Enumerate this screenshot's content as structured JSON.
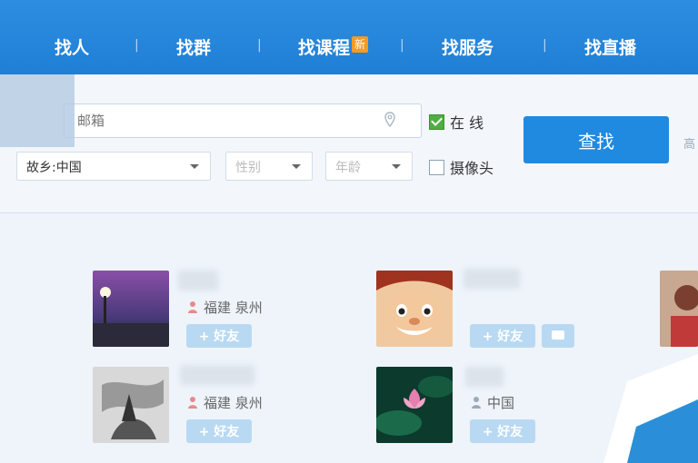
{
  "nav": {
    "tabs": [
      "找人",
      "找群",
      "找课程",
      "找服务",
      "找直播"
    ],
    "new_badge": "新",
    "separator": "|"
  },
  "search": {
    "placeholder": "邮箱",
    "online_label": "在 线",
    "online_checked": true,
    "camera_label": "摄像头",
    "camera_checked": false,
    "button_label": "查找",
    "hometown_value": "故乡:中国",
    "gender_placeholder": "性别",
    "age_placeholder": "年龄",
    "cut_label": "高"
  },
  "results": [
    {
      "location": "福建 泉州",
      "add_label": "+ 好友",
      "icon": "person-icon"
    },
    {
      "location": "福建 泉州",
      "add_label": "+ 好友",
      "icon": "person-icon"
    },
    {
      "location": "",
      "add_label": "+ 好友",
      "icon": "person-icon"
    },
    {
      "location": "中国",
      "add_label": "+ 好友",
      "icon": "person-icon"
    }
  ],
  "colors": {
    "nav_blue": "#1f7fd6",
    "button_blue": "#2089e0",
    "checkbox_green": "#4fae42",
    "add_button": "#b9d9f2"
  }
}
